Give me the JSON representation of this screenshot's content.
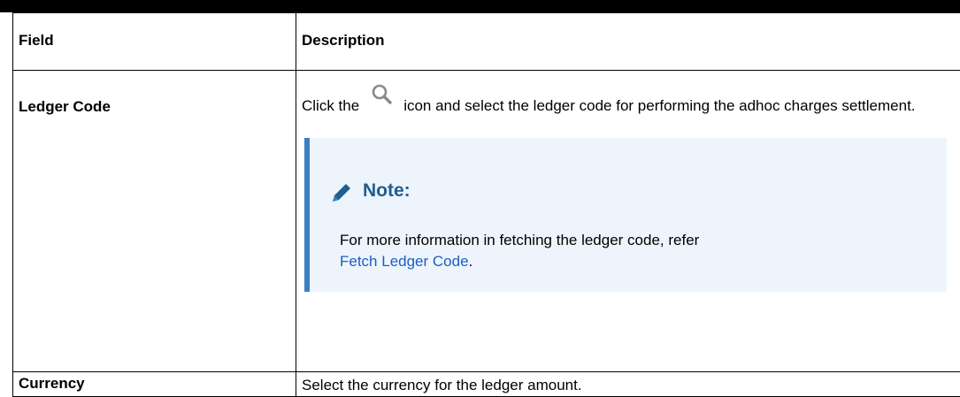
{
  "table": {
    "headers": {
      "field": "Field",
      "description": "Description"
    },
    "rows": [
      {
        "field": "Ledger Code",
        "description_before_icon": "Click the",
        "description_after_icon": "icon and select the ledger code for performing the adhoc charges settlement.",
        "icon": "search-icon",
        "note": {
          "icon": "pencil-icon",
          "title": "Note:",
          "text": "For more information in fetching the ledger code, refer",
          "link_text": "Fetch Ledger Code",
          "trailing": "."
        }
      },
      {
        "field": "Currency",
        "description": "Select the currency for the ledger amount."
      }
    ]
  },
  "colors": {
    "note_background": "#eef4fb",
    "note_accent": "#3c7fc3",
    "note_title": "#1f5d93",
    "link": "#1b5ec5"
  }
}
